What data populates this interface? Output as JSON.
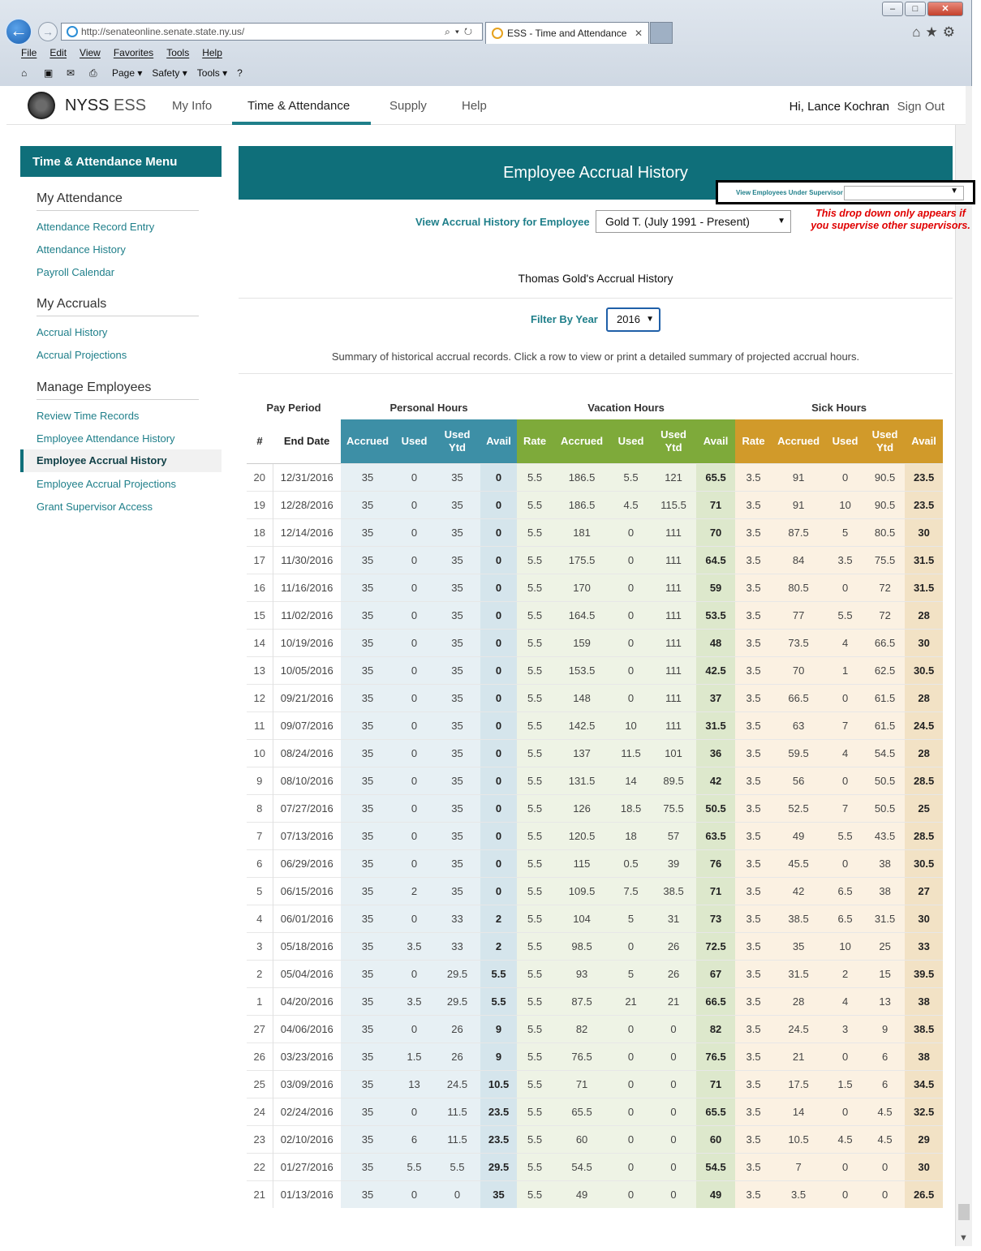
{
  "browser": {
    "url": "http://senateonline.senate.state.ny.us/",
    "tab_title": "ESS - Time and Attendance",
    "menu": [
      "File",
      "Edit",
      "View",
      "Favorites",
      "Tools",
      "Help"
    ],
    "commands": [
      "Page ▾",
      "Safety ▾",
      "Tools ▾"
    ]
  },
  "header": {
    "brand": "NYSS",
    "brand_sub": "ESS",
    "nav": [
      "My Info",
      "Time & Attendance",
      "Supply",
      "Help"
    ],
    "greeting": "Hi, Lance Kochran",
    "sign_out": "Sign Out"
  },
  "sidebar": {
    "title": "Time & Attendance Menu",
    "sections": [
      {
        "heading": "My Attendance",
        "links": [
          "Attendance Record Entry",
          "Attendance History",
          "Payroll Calendar"
        ]
      },
      {
        "heading": "My Accruals",
        "links": [
          "Accrual History",
          "Accrual Projections"
        ]
      },
      {
        "heading": "Manage Employees",
        "links": [
          "Review Time Records",
          "Employee Attendance History",
          "Employee Accrual History",
          "Employee Accrual Projections",
          "Grant Supervisor Access"
        ]
      }
    ],
    "active": "Employee Accrual History"
  },
  "main": {
    "title": "Employee Accrual History",
    "employee_label": "View Accrual History for Employee",
    "employee_value": "Gold T. (July 1991 - Present)",
    "supervisor_label": "View Employees Under Supervisor",
    "supervisor_value": "",
    "annotation": "This drop down only appears if you supervise other supervisors.",
    "card_title": "Thomas Gold's Accrual History",
    "filter_label": "Filter By Year",
    "filter_value": "2016",
    "summary": "Summary of historical accrual records. Click a row to view or print a detailed summary of projected accrual hours."
  },
  "table": {
    "groups": {
      "pay_period": "Pay Period",
      "personal": "Personal Hours",
      "vacation": "Vacation Hours",
      "sick": "Sick Hours"
    },
    "headers": [
      "#",
      "End Date",
      "Accrued",
      "Used",
      "Used Ytd",
      "Avail",
      "Rate",
      "Accrued",
      "Used",
      "Used Ytd",
      "Avail",
      "Rate",
      "Accrued",
      "Used",
      "Used Ytd",
      "Avail"
    ],
    "rows": [
      [
        "20",
        "12/31/2016",
        "35",
        "0",
        "35",
        "0",
        "5.5",
        "186.5",
        "5.5",
        "121",
        "65.5",
        "3.5",
        "91",
        "0",
        "90.5",
        "23.5"
      ],
      [
        "19",
        "12/28/2016",
        "35",
        "0",
        "35",
        "0",
        "5.5",
        "186.5",
        "4.5",
        "115.5",
        "71",
        "3.5",
        "91",
        "10",
        "90.5",
        "23.5"
      ],
      [
        "18",
        "12/14/2016",
        "35",
        "0",
        "35",
        "0",
        "5.5",
        "181",
        "0",
        "111",
        "70",
        "3.5",
        "87.5",
        "5",
        "80.5",
        "30"
      ],
      [
        "17",
        "11/30/2016",
        "35",
        "0",
        "35",
        "0",
        "5.5",
        "175.5",
        "0",
        "111",
        "64.5",
        "3.5",
        "84",
        "3.5",
        "75.5",
        "31.5"
      ],
      [
        "16",
        "11/16/2016",
        "35",
        "0",
        "35",
        "0",
        "5.5",
        "170",
        "0",
        "111",
        "59",
        "3.5",
        "80.5",
        "0",
        "72",
        "31.5"
      ],
      [
        "15",
        "11/02/2016",
        "35",
        "0",
        "35",
        "0",
        "5.5",
        "164.5",
        "0",
        "111",
        "53.5",
        "3.5",
        "77",
        "5.5",
        "72",
        "28"
      ],
      [
        "14",
        "10/19/2016",
        "35",
        "0",
        "35",
        "0",
        "5.5",
        "159",
        "0",
        "111",
        "48",
        "3.5",
        "73.5",
        "4",
        "66.5",
        "30"
      ],
      [
        "13",
        "10/05/2016",
        "35",
        "0",
        "35",
        "0",
        "5.5",
        "153.5",
        "0",
        "111",
        "42.5",
        "3.5",
        "70",
        "1",
        "62.5",
        "30.5"
      ],
      [
        "12",
        "09/21/2016",
        "35",
        "0",
        "35",
        "0",
        "5.5",
        "148",
        "0",
        "111",
        "37",
        "3.5",
        "66.5",
        "0",
        "61.5",
        "28"
      ],
      [
        "11",
        "09/07/2016",
        "35",
        "0",
        "35",
        "0",
        "5.5",
        "142.5",
        "10",
        "111",
        "31.5",
        "3.5",
        "63",
        "7",
        "61.5",
        "24.5"
      ],
      [
        "10",
        "08/24/2016",
        "35",
        "0",
        "35",
        "0",
        "5.5",
        "137",
        "11.5",
        "101",
        "36",
        "3.5",
        "59.5",
        "4",
        "54.5",
        "28"
      ],
      [
        "9",
        "08/10/2016",
        "35",
        "0",
        "35",
        "0",
        "5.5",
        "131.5",
        "14",
        "89.5",
        "42",
        "3.5",
        "56",
        "0",
        "50.5",
        "28.5"
      ],
      [
        "8",
        "07/27/2016",
        "35",
        "0",
        "35",
        "0",
        "5.5",
        "126",
        "18.5",
        "75.5",
        "50.5",
        "3.5",
        "52.5",
        "7",
        "50.5",
        "25"
      ],
      [
        "7",
        "07/13/2016",
        "35",
        "0",
        "35",
        "0",
        "5.5",
        "120.5",
        "18",
        "57",
        "63.5",
        "3.5",
        "49",
        "5.5",
        "43.5",
        "28.5"
      ],
      [
        "6",
        "06/29/2016",
        "35",
        "0",
        "35",
        "0",
        "5.5",
        "115",
        "0.5",
        "39",
        "76",
        "3.5",
        "45.5",
        "0",
        "38",
        "30.5"
      ],
      [
        "5",
        "06/15/2016",
        "35",
        "2",
        "35",
        "0",
        "5.5",
        "109.5",
        "7.5",
        "38.5",
        "71",
        "3.5",
        "42",
        "6.5",
        "38",
        "27"
      ],
      [
        "4",
        "06/01/2016",
        "35",
        "0",
        "33",
        "2",
        "5.5",
        "104",
        "5",
        "31",
        "73",
        "3.5",
        "38.5",
        "6.5",
        "31.5",
        "30"
      ],
      [
        "3",
        "05/18/2016",
        "35",
        "3.5",
        "33",
        "2",
        "5.5",
        "98.5",
        "0",
        "26",
        "72.5",
        "3.5",
        "35",
        "10",
        "25",
        "33"
      ],
      [
        "2",
        "05/04/2016",
        "35",
        "0",
        "29.5",
        "5.5",
        "5.5",
        "93",
        "5",
        "26",
        "67",
        "3.5",
        "31.5",
        "2",
        "15",
        "39.5"
      ],
      [
        "1",
        "04/20/2016",
        "35",
        "3.5",
        "29.5",
        "5.5",
        "5.5",
        "87.5",
        "21",
        "21",
        "66.5",
        "3.5",
        "28",
        "4",
        "13",
        "38"
      ],
      [
        "27",
        "04/06/2016",
        "35",
        "0",
        "26",
        "9",
        "5.5",
        "82",
        "0",
        "0",
        "82",
        "3.5",
        "24.5",
        "3",
        "9",
        "38.5"
      ],
      [
        "26",
        "03/23/2016",
        "35",
        "1.5",
        "26",
        "9",
        "5.5",
        "76.5",
        "0",
        "0",
        "76.5",
        "3.5",
        "21",
        "0",
        "6",
        "38"
      ],
      [
        "25",
        "03/09/2016",
        "35",
        "13",
        "24.5",
        "10.5",
        "5.5",
        "71",
        "0",
        "0",
        "71",
        "3.5",
        "17.5",
        "1.5",
        "6",
        "34.5"
      ],
      [
        "24",
        "02/24/2016",
        "35",
        "0",
        "11.5",
        "23.5",
        "5.5",
        "65.5",
        "0",
        "0",
        "65.5",
        "3.5",
        "14",
        "0",
        "4.5",
        "32.5"
      ],
      [
        "23",
        "02/10/2016",
        "35",
        "6",
        "11.5",
        "23.5",
        "5.5",
        "60",
        "0",
        "0",
        "60",
        "3.5",
        "10.5",
        "4.5",
        "4.5",
        "29"
      ],
      [
        "22",
        "01/27/2016",
        "35",
        "5.5",
        "5.5",
        "29.5",
        "5.5",
        "54.5",
        "0",
        "0",
        "54.5",
        "3.5",
        "7",
        "0",
        "0",
        "30"
      ],
      [
        "21",
        "01/13/2016",
        "35",
        "0",
        "0",
        "35",
        "5.5",
        "49",
        "0",
        "0",
        "49",
        "3.5",
        "3.5",
        "0",
        "0",
        "26.5"
      ]
    ]
  }
}
